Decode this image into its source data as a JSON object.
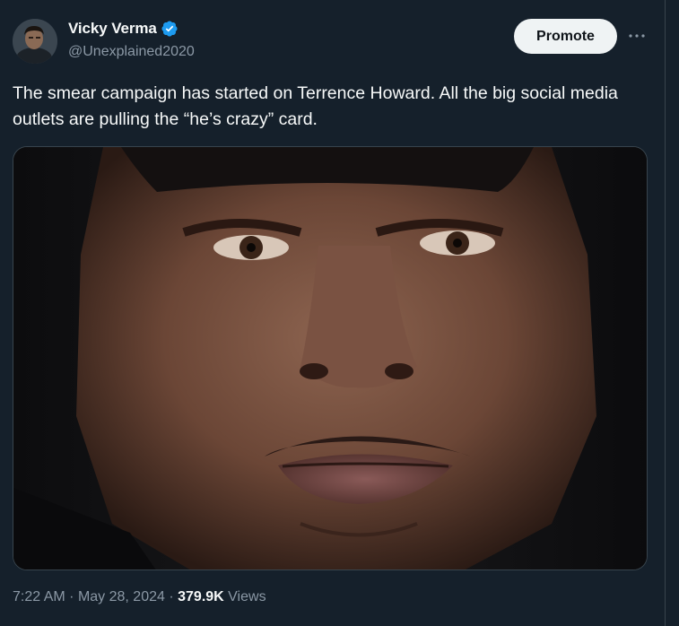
{
  "author": {
    "display_name": "Vicky Verma",
    "handle": "@Unexplained2020",
    "verified": true
  },
  "promote_label": "Promote",
  "more_label": "···",
  "tweet_text": "The smear campaign has started on Terrence Howard. All the big social media outlets are pulling the “he’s crazy” card.",
  "meta": {
    "time": "7:22 AM",
    "separator": "·",
    "date": "May 28, 2024",
    "views_count": "379.9K",
    "views_label": "Views"
  },
  "colors": {
    "background": "#15202b",
    "text_primary": "#f7f9f9",
    "text_secondary": "#8b98a5",
    "verified_blue": "#1d9bf0",
    "promote_bg": "#eff3f4"
  }
}
